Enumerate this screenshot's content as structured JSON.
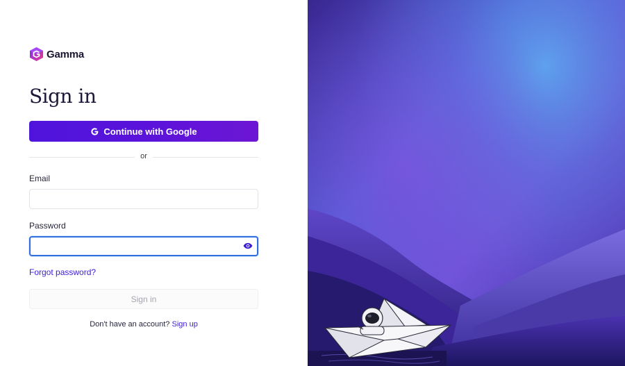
{
  "brand": {
    "name": "Gamma",
    "logo_icon": "gamma-logo-icon",
    "colors": {
      "primary": "#5213d9",
      "link": "#3a1ed6",
      "focus": "#2f6fe0"
    }
  },
  "form": {
    "title": "Sign in",
    "google_button": {
      "label": "Continue with Google",
      "icon": "google-icon"
    },
    "divider_text": "or",
    "email": {
      "label": "Email",
      "value": "",
      "placeholder": ""
    },
    "password": {
      "label": "Password",
      "value": "",
      "placeholder": "",
      "toggle_icon": "eye-icon"
    },
    "forgot_link": "Forgot password?",
    "submit_label": "Sign in",
    "signup_prompt": "Don't have an account?",
    "signup_link": "Sign up"
  },
  "hero": {
    "illustration": "astronaut-paper-boat-illustration"
  }
}
